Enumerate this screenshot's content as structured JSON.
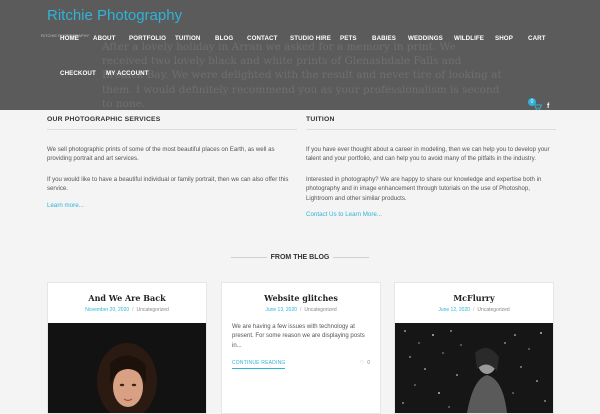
{
  "header": {
    "site_title": "Ritchie Photography",
    "tiny_logo": "RITCHIE PHOTOGRAPHY",
    "hero_text": "After a lovely holiday in Arran we asked for a memory in print. We received two lovely black and white prints of Glenashdale Falls and Brodick Bay. We were delighted with the result and never tire of looking at them. I would definitely recommend you as your professionalism is second to none.",
    "menu": [
      "HOME",
      "ABOUT",
      "PORTFOLIO",
      "TUITION",
      "BLOG",
      "CONTACT",
      "STUDIO HIRE",
      "PETS",
      "BABIES",
      "WEDDINGS",
      "WILDLIFE",
      "SHOP",
      "CART",
      "CHECKOUT",
      "MY ACCOUNT"
    ],
    "cart_count": "0",
    "cart_icon": "cart-icon",
    "social_icon": "facebook-icon"
  },
  "services": {
    "heading": "OUR PHOTOGRAPHIC SERVICES",
    "p1": "We sell photographic prints of some of the most beautiful places on Earth, as well as providing portrait and art services.",
    "p2": "If you would like to have a beautiful individual or family portrait, then we can also offer this service.",
    "link": "Learn more..."
  },
  "tuition": {
    "heading": "TUITION",
    "p1": "If you have ever thought about a career in modeling, then we can help you to develop your talent and your portfolio, and can help you to avoid many of the pitfalls in the industry.",
    "p2": "Interested in photography? We are happy to share our knowledge and expertise both in photography and in image enhancement through tutorials on the use of Photoshop, Lightroom and other similar products.",
    "link": "Contact Us to Learn More..."
  },
  "blog": {
    "heading": "FROM THE BLOG",
    "posts": [
      {
        "title": "And We Are Back",
        "date": "November 20, 2020",
        "separator": "/",
        "category": "Uncategorized"
      },
      {
        "title": "Website glitches",
        "date": "June 13, 2020",
        "separator": "/",
        "category": "Uncategorized",
        "excerpt": "We are having a few issues with technology at present. For some reason we are displaying posts in...",
        "more": "CONTINUE READING",
        "likes": "0"
      },
      {
        "title": "McFlurry",
        "date": "June 12, 2020",
        "separator": "/",
        "category": "Uncategorized"
      }
    ]
  },
  "colors": {
    "accent": "#2fb3d8",
    "header_bg": "#5b5b5b",
    "page_bg": "#f4f4f4"
  }
}
